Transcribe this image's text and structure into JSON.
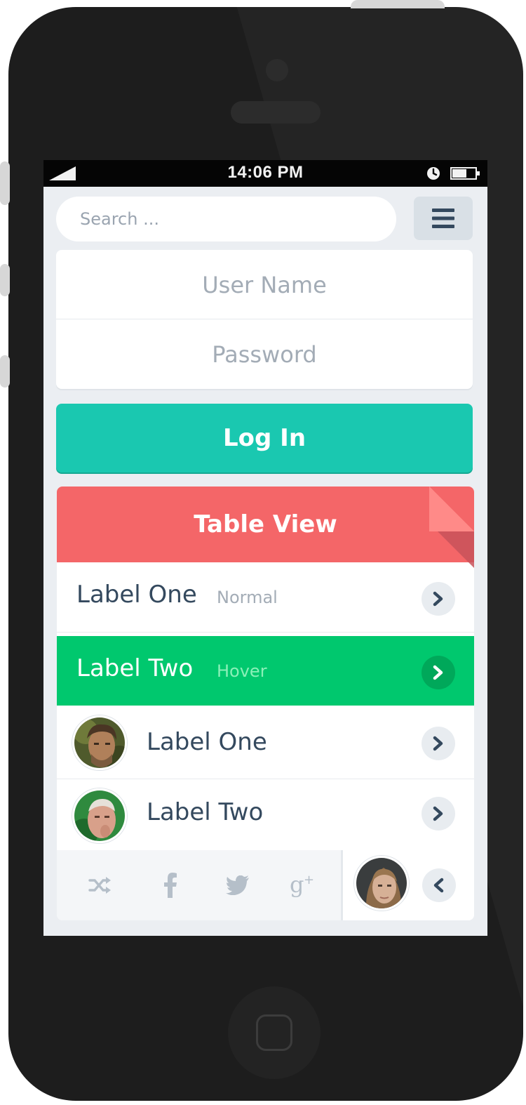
{
  "statusbar": {
    "time": "14:06 PM",
    "signal_icon": "signal-icon",
    "clock_icon": "clock-icon",
    "battery_icon": "battery-icon"
  },
  "search": {
    "placeholder": "Search ...",
    "menu_icon": "hamburger-menu-icon"
  },
  "login": {
    "username_placeholder": "User Name",
    "password_placeholder": "Password",
    "button_label": "Log In"
  },
  "table": {
    "title": "Table View",
    "rows": [
      {
        "label": "Label One",
        "sub": "Normal",
        "state": "normal"
      },
      {
        "label": "Label Two",
        "sub": "Hover",
        "state": "hover"
      },
      {
        "label": "Label One",
        "avatar": "avatar-photo"
      },
      {
        "label": "Label Two",
        "avatar": "avatar-photo"
      }
    ],
    "footer_icons": [
      "shuffle-icon",
      "facebook-icon",
      "twitter-icon",
      "google-plus-icon"
    ]
  },
  "colors": {
    "accent_turquoise": "#1ac8b0",
    "header_red": "#f46668",
    "hover_green": "#00c86e",
    "text_dark": "#34495e",
    "placeholder_gray": "#a3acb6"
  }
}
